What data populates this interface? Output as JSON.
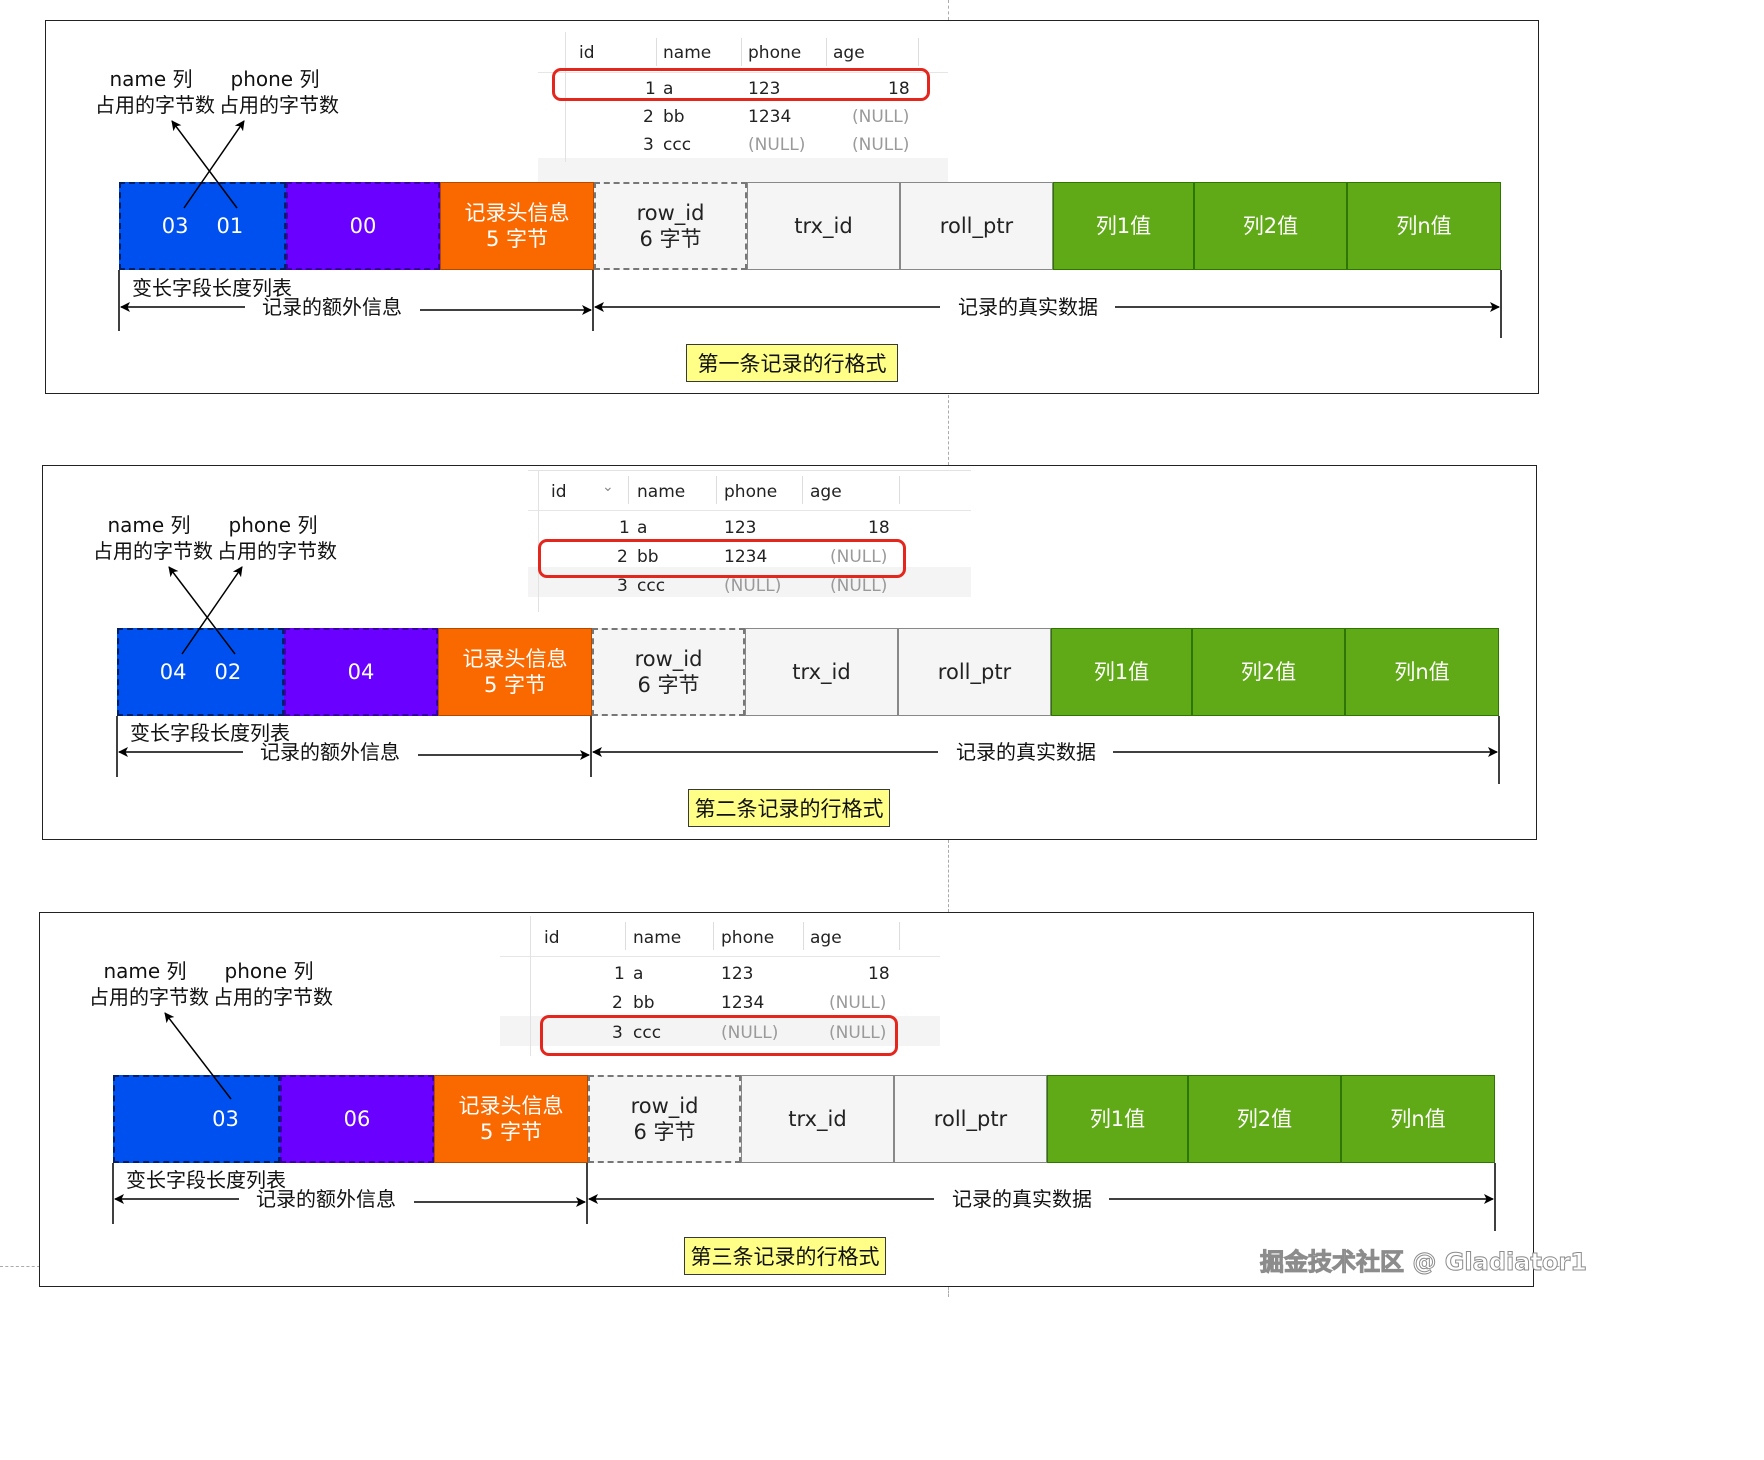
{
  "table_header": {
    "id": "id",
    "name": "name",
    "phone": "phone",
    "age": "age"
  },
  "table_rows": [
    {
      "id": "1",
      "name": "a",
      "phone": "123",
      "age": "18"
    },
    {
      "id": "2",
      "name": "bb",
      "phone": "1234",
      "age": "(NULL)"
    },
    {
      "id": "3",
      "name": "ccc",
      "phone": "(NULL)",
      "age": "(NULL)"
    }
  ],
  "labels": {
    "name_col": "name 列",
    "phone_col": "phone 列",
    "bytes_used": "占用的字节数",
    "header_info_1": "记录头信息",
    "header_info_2": "5 字节",
    "row_id_1": "row_id",
    "row_id_2": "6 字节",
    "trx_id": "trx_id",
    "roll_ptr": "roll_ptr",
    "col1": "列1值",
    "col2": "列2值",
    "coln": "列n值",
    "var_len_list": "变长字段长度列表",
    "extra_info": "记录的额外信息",
    "real_data": "记录的真实数据"
  },
  "panels": [
    {
      "caption": "第一条记录的行格式",
      "var_len_a": "03",
      "var_len_b": "01",
      "null_list": "00",
      "highlight_row": 1
    },
    {
      "caption": "第二条记录的行格式",
      "var_len_a": "04",
      "var_len_b": "02",
      "null_list": "04",
      "highlight_row": 2
    },
    {
      "caption": "第三条记录的行格式",
      "var_len_a": "03",
      "var_len_b": "",
      "null_list": "06",
      "highlight_row": 3
    }
  ],
  "watermark": "掘金技术社区 @ Gladiator1",
  "colors": {
    "var_len": "#0050ef",
    "null_list": "#6a00ff",
    "header": "#fa6800",
    "hidden_cols": "#f5f5f5",
    "data_cols": "#60a917",
    "highlight": "#e4261d",
    "caption_bg": "#ffff88"
  }
}
